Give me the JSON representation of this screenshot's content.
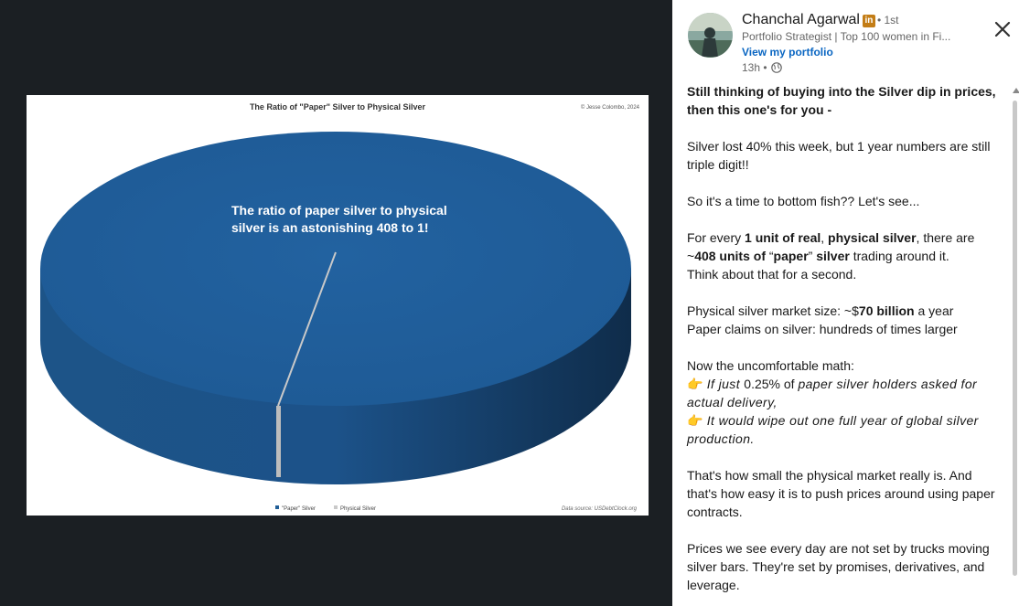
{
  "post": {
    "author": "Chanchal Agarwal",
    "degree": "• 1st",
    "headline": "Portfolio Strategist | Top 100 women in Fi...",
    "link": "View my portfolio",
    "time": "13h •",
    "lines": {
      "p1a": "Still thinking of buying into the Silver dip in prices,",
      "p1b": "then this one's for you -",
      "p2a": "Silver lost 40% this week, but 1 year numbers are still",
      "p2b": "triple digit!!",
      "p3": "So it's a time to bottom fish?? Let's see...",
      "p4a_1": "For every ",
      "p4a_2": "1 unit of real",
      "p4a_3": ", ",
      "p4a_4": "physical silver",
      "p4a_5": ", there are",
      "p4b_1": "~",
      "p4b_2": "408 units of",
      "p4b_3": " “",
      "p4b_4": "paper",
      "p4b_5": "” ",
      "p4b_6": "silver",
      "p4b_7": " trading around it.",
      "p4c": "Think about that for a second.",
      "p5a_1": "Physical silver market size: ~$",
      "p5a_2": "70 billion",
      "p5a_3": " a year",
      "p5b": "Paper claims on silver: hundreds of times larger",
      "p6a": "Now the uncomfortable math:",
      "p6b_emoji": "👉",
      "p6b_1": " If just ",
      "p6b_2": "0.25% of ",
      "p6b_3": "paper silver holders asked for",
      "p6c": "actual delivery,",
      "p6d_emoji": "👉",
      "p6d": " It would wipe out one full year of global silver",
      "p6e": "production.",
      "p7a": "That's how small the physical market really is. And",
      "p7b": "that's how easy it is to push prices around using paper",
      "p7c": "contracts.",
      "p8a": "Prices we see every day are not set by trucks moving",
      "p8b": "silver bars. They're set by promises, derivatives, and",
      "p8c": "leverage."
    }
  },
  "image": {
    "title": "The Ratio of \"Paper\" Silver to Physical Silver",
    "copyright": "© Jesse Colombo, 2024",
    "overlay_line1": "The ratio of paper silver to physical",
    "overlay_line2": "silver is an astonishing 408 to 1!",
    "legend_paper": "\"Paper\" Silver",
    "legend_physical": "Physical Silver",
    "source": "Data source: USDebtClock.org"
  },
  "chart_data": {
    "type": "pie",
    "title": "The Ratio of \"Paper\" Silver to Physical Silver",
    "categories": [
      "\"Paper\" Silver",
      "Physical Silver"
    ],
    "values": [
      408,
      1
    ],
    "colors": [
      "#215f97",
      "#c9c9c9"
    ],
    "legend": "bottom"
  },
  "colors": {
    "background": "#1b1f23",
    "pie_top": "#215f97",
    "pie_side": "#1b4f82",
    "link": "#0a66c2",
    "badge": "#c37d16"
  },
  "icons": {
    "close": "close-icon",
    "globe": "globe-icon",
    "linkedin": "linkedin-badge-icon"
  }
}
